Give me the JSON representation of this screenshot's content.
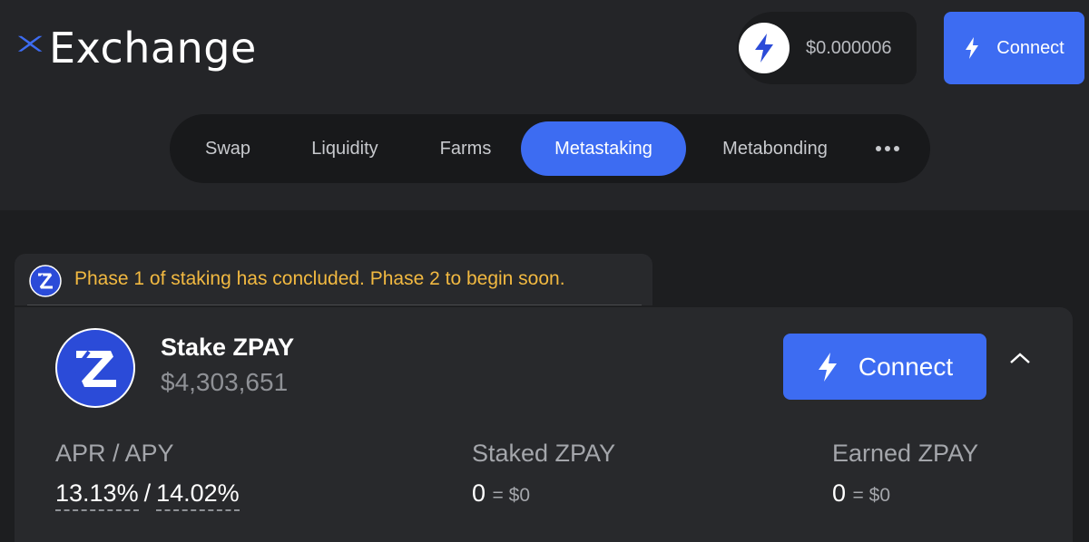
{
  "app": {
    "logo_text": "Exchange"
  },
  "header": {
    "price": "$0.000006",
    "connect_label": "Connect"
  },
  "nav": {
    "tabs": [
      {
        "label": "Swap",
        "active": false
      },
      {
        "label": "Liquidity",
        "active": false
      },
      {
        "label": "Farms",
        "active": false
      },
      {
        "label": "Metastaking",
        "active": true
      },
      {
        "label": "Metabonding",
        "active": false
      }
    ],
    "more_icon": "more-horizontal-icon"
  },
  "notice": {
    "text": "Phase 1 of staking has concluded. Phase 2 to begin soon."
  },
  "card": {
    "title": "Stake ZPAY",
    "tvl": "$4,303,651",
    "connect_label": "Connect",
    "stats": {
      "apr_label": "APR / APY",
      "apr": "13.13%",
      "separator": "/",
      "apy": "14.02%",
      "staked_label": "Staked ZPAY",
      "staked_value": "0",
      "staked_usd": "= $0",
      "earned_label": "Earned ZPAY",
      "earned_value": "0",
      "earned_usd": "= $0"
    }
  },
  "colors": {
    "accent": "#3d6cf2",
    "background": "#1d1e20",
    "panel": "#28292c",
    "warning": "#f2b941"
  }
}
